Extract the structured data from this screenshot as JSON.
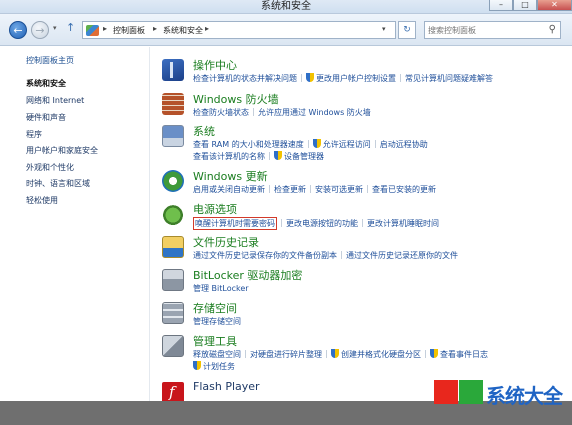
{
  "window": {
    "title": "系统和安全",
    "minimize_glyph": "–",
    "maximize_glyph": "□",
    "close_glyph": "✕"
  },
  "address": {
    "back_glyph": "←",
    "forward_glyph": "→",
    "history_glyph": "▾",
    "up_glyph": "↑",
    "crumbs": [
      "控制面板",
      "系统和安全"
    ],
    "sep_glyph": "▸",
    "dropdown_glyph": "▾",
    "refresh_glyph": "↻",
    "search_placeholder": "搜索控制面板",
    "search_glyph": "⚲"
  },
  "sidebar": {
    "items": [
      {
        "label": "控制面板主页"
      },
      {
        "label": "系统和安全"
      },
      {
        "label": "网络和 Internet"
      },
      {
        "label": "硬件和声音"
      },
      {
        "label": "程序"
      },
      {
        "label": "用户帐户和家庭安全"
      },
      {
        "label": "外观和个性化"
      },
      {
        "label": "时钟、语言和区域"
      },
      {
        "label": "轻松使用"
      }
    ]
  },
  "categories": [
    {
      "icon": "flag-icon",
      "title": "操作中心",
      "links": [
        "检查计算机的状态并解决问题",
        "更改用户帐户控制设置",
        "常见计算机问题疑难解答"
      ]
    },
    {
      "icon": "firewall-icon",
      "title": "Windows 防火墙",
      "links": [
        "检查防火墙状态",
        "允许应用通过 Windows 防火墙"
      ]
    },
    {
      "icon": "computer-icon",
      "title": "系统",
      "links": [
        "查看 RAM 的大小和处理器速度",
        "允许远程访问",
        "启动远程协助"
      ],
      "links2": [
        "查看该计算机的名称",
        "设备管理器"
      ]
    },
    {
      "icon": "windows-update-icon",
      "title": "Windows 更新",
      "links": [
        "启用或关闭自动更新",
        "检查更新",
        "安装可选更新",
        "查看已安装的更新"
      ]
    },
    {
      "icon": "power-icon",
      "title": "电源选项",
      "links": [
        "唤醒计算机时需要密码",
        "更改电源按钮的功能",
        "更改计算机睡眠时间"
      ]
    },
    {
      "icon": "file-history-icon",
      "title": "文件历史记录",
      "links": [
        "通过文件历史记录保存你的文件备份副本",
        "通过文件历史记录还原你的文件"
      ]
    },
    {
      "icon": "bitlocker-icon",
      "title": "BitLocker 驱动器加密",
      "links": [
        "管理 BitLocker"
      ]
    },
    {
      "icon": "storage-spaces-icon",
      "title": "存储空间",
      "links": [
        "管理存储空间"
      ]
    },
    {
      "icon": "admin-tools-icon",
      "title": "管理工具",
      "links": [
        "释放磁盘空间",
        "对硬盘进行碎片整理",
        "创建并格式化硬盘分区",
        "查看事件日志"
      ],
      "links2": [
        "计划任务"
      ]
    },
    {
      "icon": "flash-player-icon",
      "title": "Flash Player",
      "links": []
    }
  ],
  "watermark": {
    "text": "系统大全",
    "colors": [
      "#e8271d",
      "#2aa83a",
      "#1f64c4"
    ]
  }
}
